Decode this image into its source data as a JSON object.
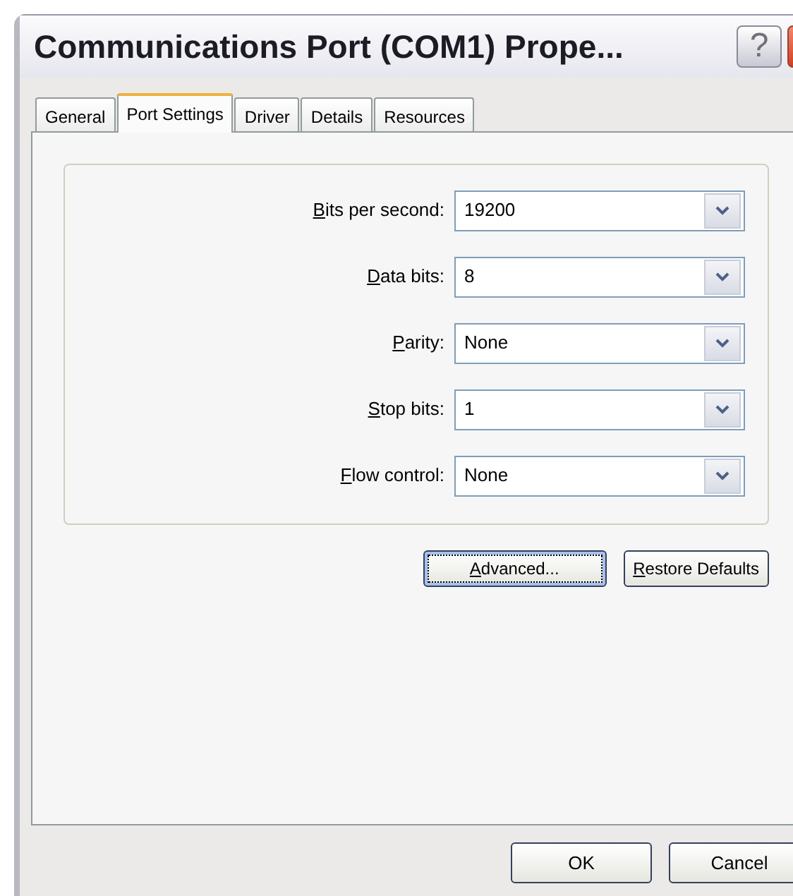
{
  "window": {
    "title": "Communications Port (COM1) Prope..."
  },
  "title_buttons": [
    {
      "kind": "help",
      "text": "?"
    },
    {
      "kind": "close"
    }
  ],
  "tabs": [
    {
      "label": "General",
      "selected": false
    },
    {
      "label": "Port Settings",
      "selected": true
    },
    {
      "label": "Driver",
      "selected": false
    },
    {
      "label": "Details",
      "selected": false
    },
    {
      "label": "Resources",
      "selected": false
    }
  ],
  "settings": [
    {
      "access_key": "B",
      "label_rest": "its per second:",
      "value": "19200"
    },
    {
      "access_key": "D",
      "label_rest": "ata bits:",
      "value": "8"
    },
    {
      "access_key": "P",
      "label_rest": "arity:",
      "value": "None"
    },
    {
      "access_key": "S",
      "label_rest": "top bits:",
      "value": "1"
    },
    {
      "access_key": "F",
      "label_rest": "low control:",
      "value": "None"
    }
  ],
  "panel_buttons": [
    {
      "access_key": "A",
      "label_rest": "dvanced...",
      "focused": true
    },
    {
      "access_key": "R",
      "label_rest": "estore Defaults",
      "focused": false
    }
  ],
  "dialog_buttons": [
    "OK",
    "Cancel"
  ]
}
